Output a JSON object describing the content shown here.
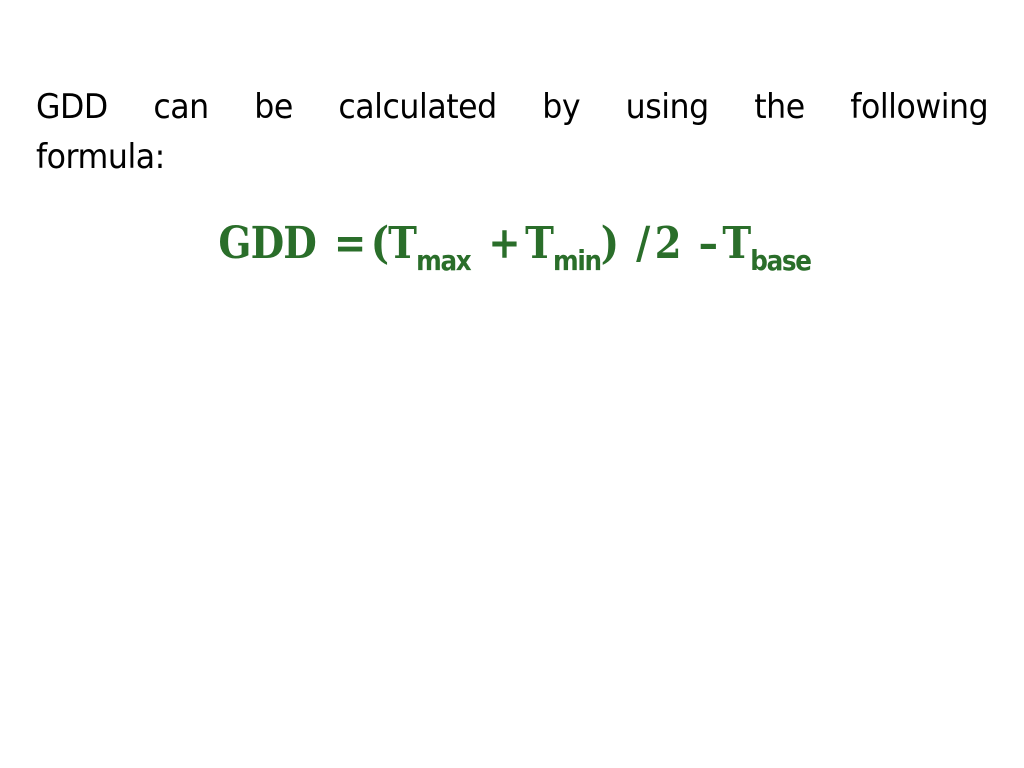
{
  "slide": {
    "body_words_line1": [
      "GDD",
      "can",
      "be",
      "calculated",
      "by",
      "using",
      "the",
      "following"
    ],
    "body_line2": "formula:",
    "formula": {
      "lhs": "GDD",
      "equals": "=",
      "open_paren": "(",
      "t1": "T",
      "t1_sub": "max",
      "plus": "+",
      "t2": "T",
      "t2_sub": "min",
      "close_paren": ")",
      "divide": "/",
      "divisor": "2",
      "minus": "–",
      "t3": "T",
      "t3_sub": "base"
    },
    "colors": {
      "text": "#000000",
      "formula": "#2a6e2a",
      "background": "#ffffff"
    }
  }
}
